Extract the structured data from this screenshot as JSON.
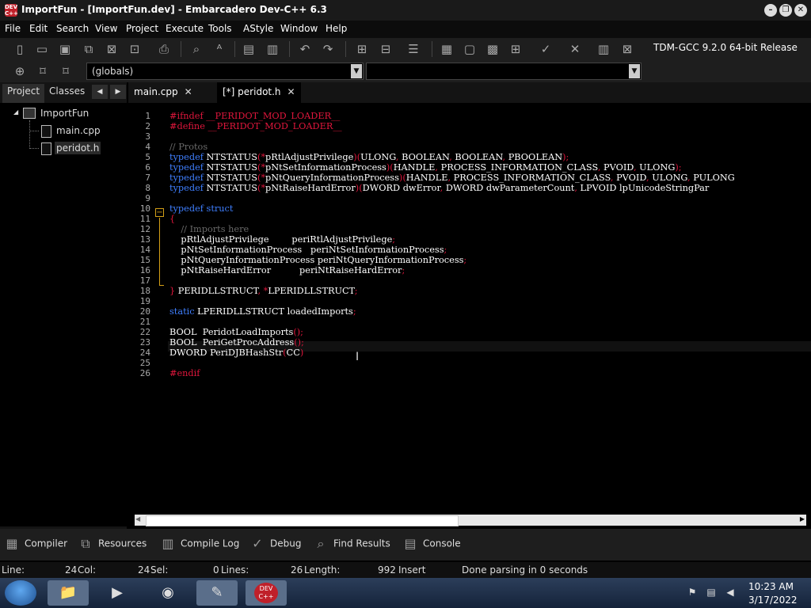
{
  "window": {
    "title": "ImportFun - [ImportFun.dev] - Embarcadero Dev-C++ 6.3",
    "icon_text": "DEV C++"
  },
  "menu": [
    "File",
    "Edit",
    "Search",
    "View",
    "Project",
    "Execute",
    "Tools",
    "AStyle",
    "Window",
    "Help"
  ],
  "toolbar": {
    "compiler": "TDM-GCC 9.2.0 64-bit Release",
    "scope": "(globals)"
  },
  "left_tabs": [
    "Project",
    "Classes"
  ],
  "tree": {
    "project": "ImportFun",
    "files": [
      "main.cpp",
      "peridot.h"
    ]
  },
  "editor_tabs": [
    {
      "label": "main.cpp",
      "close": "✕"
    },
    {
      "label": "[*] peridot.h",
      "close": "✕"
    }
  ],
  "code_lines": [
    "#ifndef __PERIDOT_MOD_LOADER__",
    "#define __PERIDOT_MOD_LOADER__",
    "",
    "// Protos",
    "typedef NTSTATUS(*pRtlAdjustPrivilege)(ULONG, BOOLEAN, BOOLEAN, PBOOLEAN);",
    "typedef NTSTATUS(*pNtSetInformationProcess)(HANDLE, PROCESS_INFORMATION_CLASS, PVOID, ULONG);",
    "typedef NTSTATUS(*pNtQueryInformationProcess)(HANDLE, PROCESS_INFORMATION_CLASS, PVOID, ULONG, PULONG",
    "typedef NTSTATUS(*pNtRaiseHardError)(DWORD dwError, DWORD dwParameterCount, LPVOID lpUnicodeStringPar",
    "",
    "typedef struct",
    "{",
    "    // Imports here",
    "    pRtlAdjustPrivilege        periRtlAdjustPrivilege;",
    "    pNtSetInformationProcess   periNtSetInformationProcess;",
    "    pNtQueryInformationProcess periNtQueryInformationProcess;",
    "    pNtRaiseHardError          periNtRaiseHardError;",
    "",
    "} PERIDLLSTRUCT, *LPERIDLLSTRUCT;",
    "",
    "static LPERIDLLSTRUCT loadedImports;",
    "",
    "BOOL  PeridotLoadImports();",
    "BOOL  PeriGetProcAddress();",
    "DWORD PeriDJBHashStr(CC)",
    "",
    "#endif"
  ],
  "colors": {
    "keyword": "#3f7fff",
    "preprocessor": "#e0163c",
    "comment": "#6a6a6a",
    "text": "#ffffff",
    "punct": "#e0163c"
  },
  "bottom_tabs": [
    "Compiler",
    "Resources",
    "Compile Log",
    "Debug",
    "Find Results",
    "Console"
  ],
  "status": {
    "line_label": "Line:",
    "line": "24",
    "col_label": "Col:",
    "col": "24",
    "sel_label": "Sel:",
    "sel": "0",
    "lines_label": "Lines:",
    "lines": "26",
    "length_label": "Length:",
    "length": "992",
    "mode": "Insert",
    "message": "Done parsing in 0 seconds"
  },
  "clock": {
    "time": "10:23 AM",
    "date": "3/17/2022"
  },
  "taskbar_icons": [
    "start-orb-icon",
    "explorer-icon",
    "media-player-icon",
    "chrome-icon",
    "notepad-icon",
    "devcpp-icon"
  ]
}
